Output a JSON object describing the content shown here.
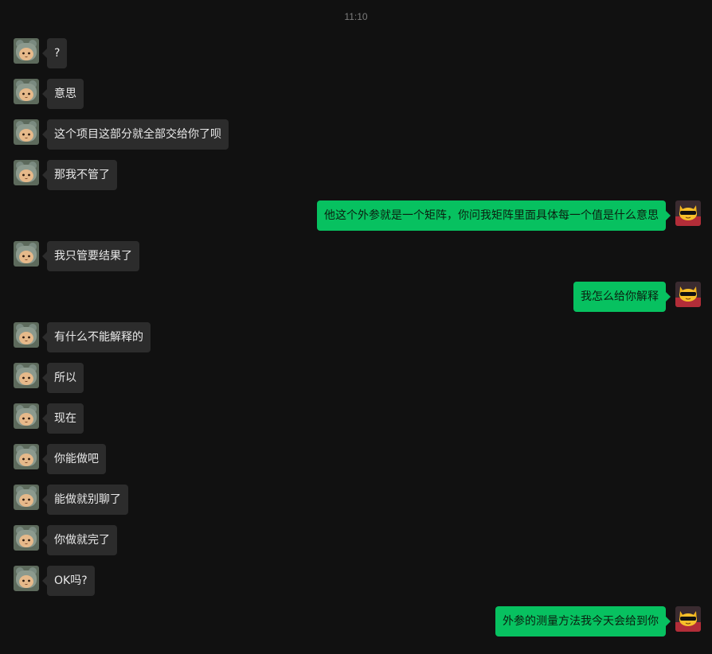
{
  "chat": {
    "timestamp": "11:10",
    "messages": [
      {
        "side": "left",
        "text": "?"
      },
      {
        "side": "left",
        "text": "意思"
      },
      {
        "side": "left",
        "text": "这个项目这部分就全部交给你了呗"
      },
      {
        "side": "left",
        "text": "那我不管了"
      },
      {
        "side": "right",
        "text": "他这个外参就是一个矩阵，你问我矩阵里面具体每一个值是什么意思"
      },
      {
        "side": "left",
        "text": "我只管要结果了"
      },
      {
        "side": "right",
        "text": "我怎么给你解释"
      },
      {
        "side": "left",
        "text": "有什么不能解释的"
      },
      {
        "side": "left",
        "text": "所以"
      },
      {
        "side": "left",
        "text": "现在"
      },
      {
        "side": "left",
        "text": "你能做吧"
      },
      {
        "side": "left",
        "text": "能做就别聊了"
      },
      {
        "side": "left",
        "text": "你做就完了"
      },
      {
        "side": "left",
        "text": "OK吗?"
      },
      {
        "side": "right",
        "text": "外参的测量方法我今天会给到你"
      }
    ]
  },
  "avatars": {
    "contact": {
      "icon": "cat-in-bear-hat-avatar-icon"
    },
    "self": {
      "icon": "yellow-cartoon-cat-sunglasses-avatar-icon"
    }
  },
  "colors": {
    "background": "#111111",
    "left_bubble": "#2c2c2c",
    "right_bubble": "#07c160",
    "timestamp": "#7c7c7c"
  }
}
